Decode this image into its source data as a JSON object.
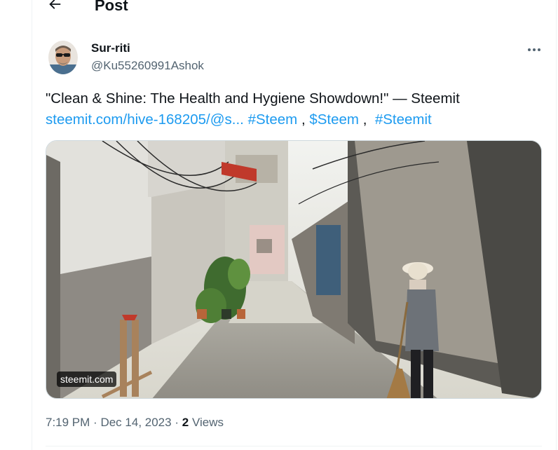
{
  "header": {
    "title": "Post",
    "back_icon": "arrow-left-icon"
  },
  "author": {
    "display_name": "Sur-riti",
    "handle": "@Ku55260991Ashok",
    "more_icon": "more-dots-icon"
  },
  "tweet": {
    "line1": "\"Clean & Shine: The Health and Hygiene Showdown!\" — Steemit",
    "link_url": "steemit.com/hive-168205/@s...",
    "hashtag1": "#Steem",
    "comma1": ",",
    "cashtag": "$Steem",
    "comma2": ",",
    "hashtag2": "#Steemit"
  },
  "media": {
    "domain_label": "steemit.com"
  },
  "meta": {
    "time": "7:19 PM",
    "dot1": "·",
    "date": "Dec 14, 2023",
    "dot2": "·",
    "views_count": "2",
    "views_label": "Views"
  },
  "colors": {
    "link": "#1d9bf0",
    "secondary_text": "#536471",
    "primary_text": "#0f1419",
    "border": "#eff3f4"
  }
}
